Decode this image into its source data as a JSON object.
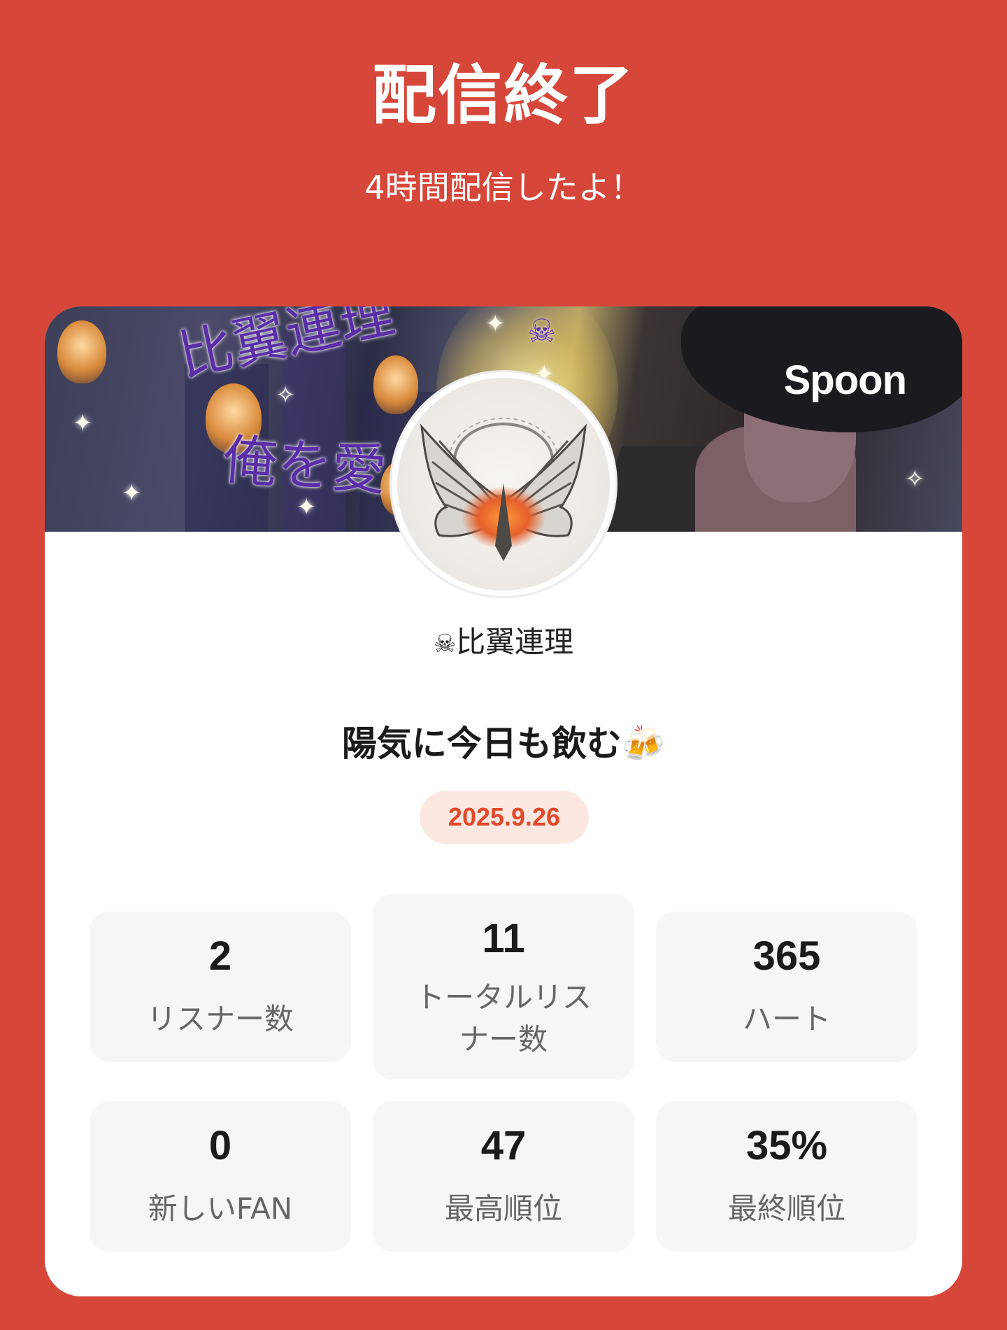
{
  "header": {
    "title": "配信終了",
    "subtitle": "4時間配信したよ！"
  },
  "banner": {
    "text_line1": "比翼連理",
    "text_line2": "俺を愛",
    "brand": "Spoon"
  },
  "profile": {
    "username": "比翼連理",
    "username_emoji": "☠",
    "stream_title": "陽気に今日も飲む🍻",
    "date": "2025.9.26"
  },
  "stats": [
    {
      "value": "2",
      "label": "リスナー数"
    },
    {
      "value": "11",
      "label": "トータルリスナー数"
    },
    {
      "value": "365",
      "label": "ハート"
    },
    {
      "value": "0",
      "label": "新しいFAN"
    },
    {
      "value": "47",
      "label": "最高順位"
    },
    {
      "value": "35%",
      "label": "最終順位"
    }
  ],
  "colors": {
    "background": "#d6473a",
    "card": "#ffffff",
    "date_badge_bg": "#fde7e1",
    "date_badge_text": "#e1492a",
    "stat_tile": "#f6f6f6"
  }
}
